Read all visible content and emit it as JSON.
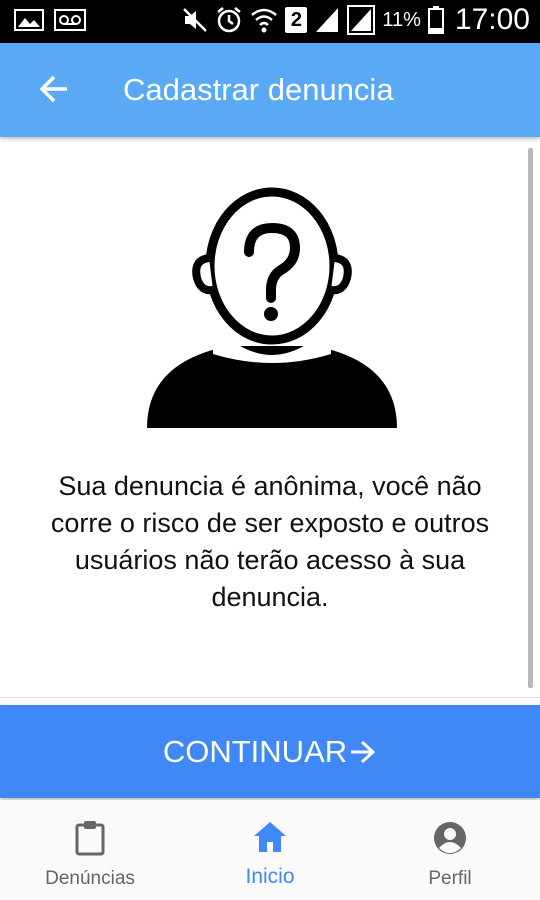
{
  "status_bar": {
    "battery_percent": "11%",
    "time": "17:00",
    "sim_slot": "2",
    "icons": [
      "gallery-icon",
      "voicemail-icon",
      "mute-icon",
      "alarm-icon",
      "wifi-icon",
      "sim-2-icon",
      "signal-icon",
      "signal-icon",
      "battery-icon"
    ]
  },
  "header": {
    "title": "Cadastrar denuncia",
    "back_icon": "arrow-left-icon"
  },
  "main": {
    "illustration": "anonymous-person-icon",
    "message": "Sua denuncia é anônima, você não corre o risco de ser exposto e outros usuários não terão acesso à sua denuncia."
  },
  "continue_button": {
    "label": "CONTINUAR",
    "icon": "arrow-right-icon",
    "color": "#3f88f6"
  },
  "bottom_nav": {
    "items": [
      {
        "label": "Denúncias",
        "icon": "clipboard-icon"
      },
      {
        "label": "Inicio",
        "icon": "home-icon",
        "active": true
      },
      {
        "label": "Perfil",
        "icon": "account-circle-icon"
      }
    ],
    "active_color": "#3f88f6",
    "inactive_color": "#666666"
  },
  "colors": {
    "appbar": "#59a9f4",
    "button": "#3f88f6"
  }
}
